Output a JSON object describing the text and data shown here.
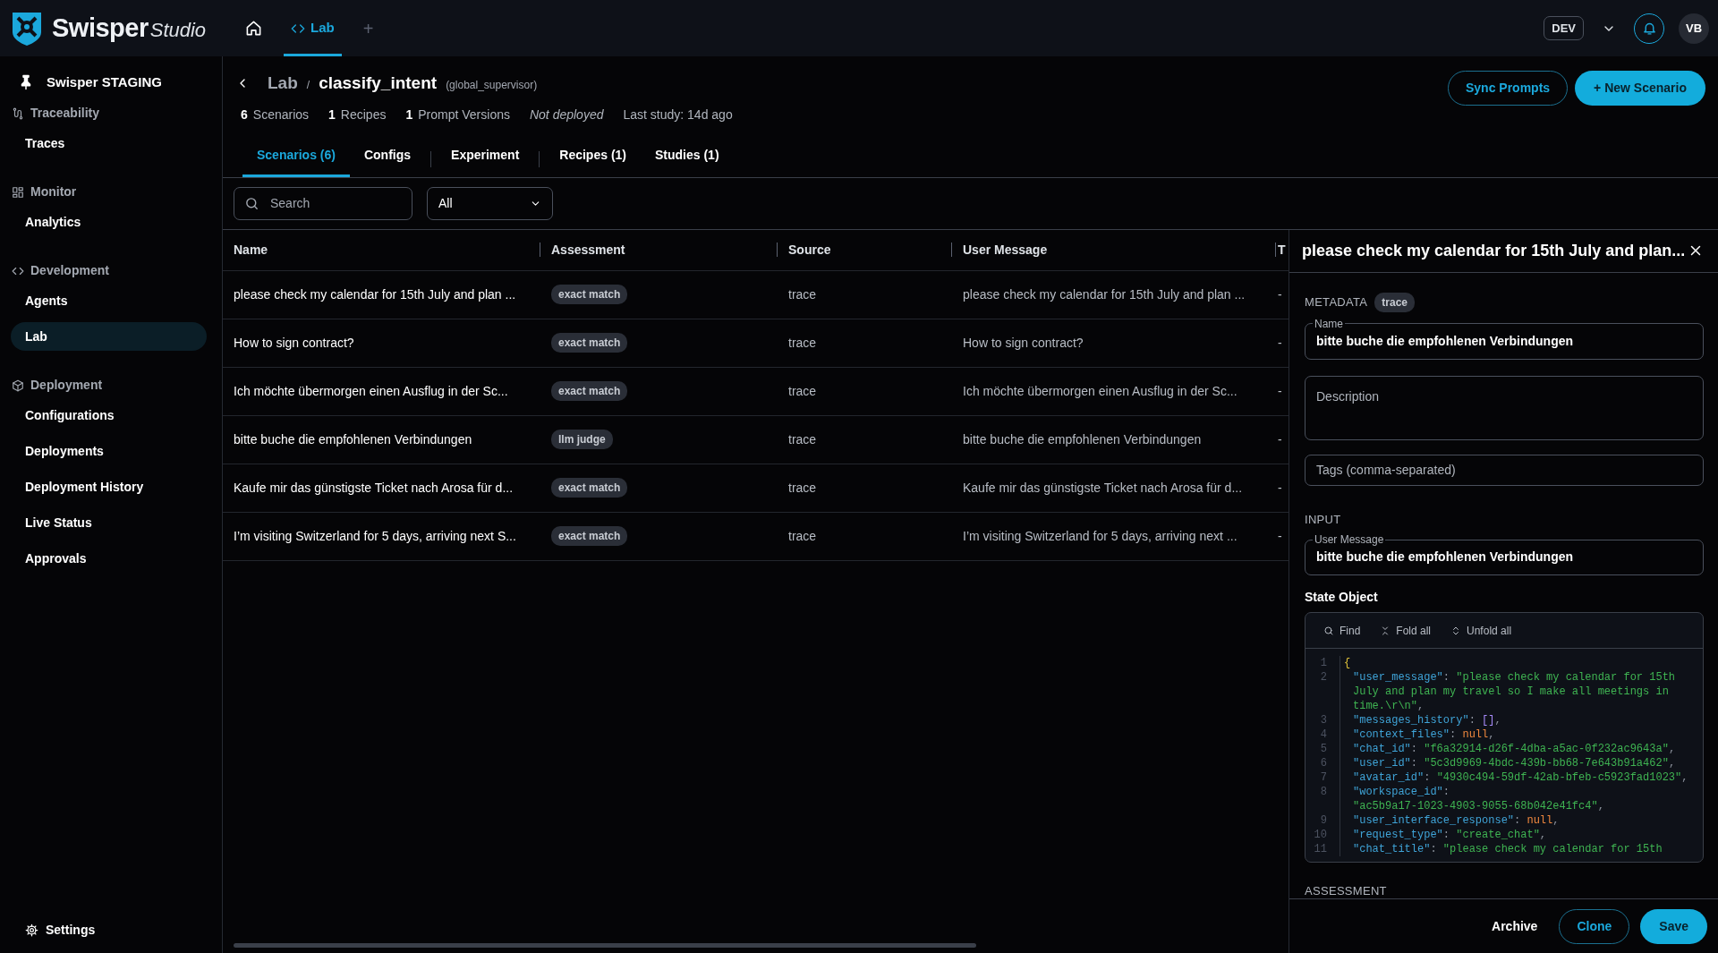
{
  "brand": {
    "name": "Swisper",
    "suffix": "Studio"
  },
  "top_nav": [
    {
      "kind": "home",
      "selected": false
    },
    {
      "kind": "code",
      "label": "Lab",
      "selected": true
    },
    {
      "kind": "add",
      "label": "+",
      "selected": false
    }
  ],
  "environment": {
    "label": "DEV"
  },
  "user": {
    "initials": "VB"
  },
  "sidebar": {
    "workspace": "Swisper STAGING",
    "sections": [
      {
        "title": "Traceability",
        "items": [
          {
            "label": "Traces",
            "selected": false
          }
        ]
      },
      {
        "title": "Monitor",
        "items": [
          {
            "label": "Analytics",
            "selected": false
          }
        ]
      },
      {
        "title": "Development",
        "items": [
          {
            "label": "Agents",
            "selected": false
          },
          {
            "label": "Lab",
            "selected": true
          }
        ]
      },
      {
        "title": "Deployment",
        "items": [
          {
            "label": "Configurations",
            "selected": false
          },
          {
            "label": "Deployments",
            "selected": false
          },
          {
            "label": "Deployment History",
            "selected": false
          },
          {
            "label": "Live Status",
            "selected": false
          },
          {
            "label": "Approvals",
            "selected": false
          }
        ]
      }
    ],
    "settings": "Settings"
  },
  "breadcrumb": {
    "parent": "Lab",
    "separator": "/",
    "current": "classify_intent",
    "context": "(global_supervisor)"
  },
  "stats": [
    {
      "kind": "count",
      "count": "6",
      "label": "Scenarios"
    },
    {
      "kind": "count",
      "count": "1",
      "label": "Recipes"
    },
    {
      "kind": "count",
      "count": "1",
      "label": "Prompt Versions"
    },
    {
      "kind": "status",
      "label": "Not deployed"
    },
    {
      "kind": "info",
      "label": "Last study: 14d ago"
    }
  ],
  "actions": [
    {
      "kind": "outline",
      "label": "Sync Prompts"
    },
    {
      "kind": "primary",
      "label": "+ New Scenario"
    }
  ],
  "tabs": [
    {
      "label": "Scenarios (6)",
      "selected": true,
      "divider_after": false
    },
    {
      "label": "Configs",
      "selected": false,
      "divider_after": true
    },
    {
      "label": "Experiment",
      "selected": false,
      "divider_after": true
    },
    {
      "label": "Recipes (1)",
      "selected": false,
      "divider_after": false
    },
    {
      "label": "Studies (1)",
      "selected": false,
      "divider_after": false
    }
  ],
  "search": {
    "placeholder": "Search"
  },
  "filter": {
    "value": "All"
  },
  "table": {
    "columns": [
      "Name",
      "Assessment",
      "Source",
      "User Message",
      "T"
    ],
    "rows": [
      {
        "name": "please check my calendar for 15th July and plan ...",
        "assessment": "exact match",
        "source": "trace",
        "user_message": "please check my calendar for 15th July and plan ...",
        "column_5": "-"
      },
      {
        "name": "How to sign contract?",
        "assessment": "exact match",
        "source": "trace",
        "user_message": "How to sign contract?",
        "column_5": "-"
      },
      {
        "name": "Ich möchte übermorgen einen Ausflug in der Sc...",
        "assessment": "exact match",
        "source": "trace",
        "user_message": "Ich möchte übermorgen einen Ausflug in der Sc...",
        "column_5": "-"
      },
      {
        "name": "bitte buche die empfohlenen Verbindungen",
        "assessment": "llm judge",
        "source": "trace",
        "user_message": "bitte buche die empfohlenen Verbindungen",
        "column_5": "-"
      },
      {
        "name": "Kaufe mir das günstigste Ticket nach Arosa für d...",
        "assessment": "exact match",
        "source": "trace",
        "user_message": "Kaufe mir das günstigste Ticket nach Arosa für d...",
        "column_5": "-"
      },
      {
        "name": "I’m visiting Switzerland for 5 days, arriving next S...",
        "assessment": "exact match",
        "source": "trace",
        "user_message": "I’m visiting Switzerland for 5 days, arriving next ...",
        "column_5": "-"
      }
    ]
  },
  "panel": {
    "title": "please check my calendar for 15th July and plan...",
    "metadata_label": "METADATA",
    "source_badge": "trace",
    "name_field": {
      "label": "Name",
      "value": "bitte buche die empfohlenen Verbindungen"
    },
    "description": {
      "placeholder": "Description"
    },
    "tags": {
      "placeholder": "Tags (comma-separated)"
    },
    "input_label": "INPUT",
    "user_message_field": {
      "label": "User Message",
      "value": "bitte buche die empfohlenen Verbindungen"
    },
    "state_object": {
      "label": "State Object",
      "toolbar": [
        {
          "kind": "find",
          "label": "Find"
        },
        {
          "kind": "fold",
          "label": "Fold all"
        },
        {
          "kind": "unfold",
          "label": "Unfold all"
        }
      ],
      "lines": [
        {
          "number": "1",
          "rows": [
            {
              "tokens": [
                {
                  "kind": "brace",
                  "text": "{"
                }
              ]
            }
          ]
        },
        {
          "number": "2",
          "rows": [
            {
              "tokens": [
                {
                  "kind": "key",
                  "text": "\"user_message\""
                },
                {
                  "kind": "punct",
                  "text": ": "
                },
                {
                  "kind": "string",
                  "text": "\"please check my calendar for 15th"
                }
              ]
            },
            {
              "tokens": [
                {
                  "kind": "string",
                  "text": "July and plan my travel so I make all meetings in"
                }
              ]
            },
            {
              "tokens": [
                {
                  "kind": "string",
                  "text": "time.\\r\\n\""
                },
                {
                  "kind": "punct",
                  "text": ","
                }
              ]
            }
          ]
        },
        {
          "number": "3",
          "rows": [
            {
              "tokens": [
                {
                  "kind": "key",
                  "text": "\"messages_history\""
                },
                {
                  "kind": "punct",
                  "text": ": "
                },
                {
                  "kind": "bracket",
                  "text": "[]"
                },
                {
                  "kind": "punct",
                  "text": ","
                }
              ]
            }
          ]
        },
        {
          "number": "4",
          "rows": [
            {
              "tokens": [
                {
                  "kind": "key",
                  "text": "\"context_files\""
                },
                {
                  "kind": "punct",
                  "text": ": "
                },
                {
                  "kind": "null",
                  "text": "null"
                },
                {
                  "kind": "punct",
                  "text": ","
                }
              ]
            }
          ]
        },
        {
          "number": "5",
          "rows": [
            {
              "tokens": [
                {
                  "kind": "key",
                  "text": "\"chat_id\""
                },
                {
                  "kind": "punct",
                  "text": ": "
                },
                {
                  "kind": "string",
                  "text": "\"f6a32914-d26f-4dba-a5ac-0f232ac9643a\""
                },
                {
                  "kind": "punct",
                  "text": ","
                }
              ]
            }
          ]
        },
        {
          "number": "6",
          "rows": [
            {
              "tokens": [
                {
                  "kind": "key",
                  "text": "\"user_id\""
                },
                {
                  "kind": "punct",
                  "text": ": "
                },
                {
                  "kind": "string",
                  "text": "\"5c3d9969-4bdc-439b-bb68-7e643b91a462\""
                },
                {
                  "kind": "punct",
                  "text": ","
                }
              ]
            }
          ]
        },
        {
          "number": "7",
          "rows": [
            {
              "tokens": [
                {
                  "kind": "key",
                  "text": "\"avatar_id\""
                },
                {
                  "kind": "punct",
                  "text": ": "
                },
                {
                  "kind": "string",
                  "text": "\"4930c494-59df-42ab-bfeb-c5923fad1023\""
                },
                {
                  "kind": "punct",
                  "text": ","
                }
              ]
            }
          ]
        },
        {
          "number": "8",
          "rows": [
            {
              "tokens": [
                {
                  "kind": "key",
                  "text": "\"workspace_id\""
                },
                {
                  "kind": "punct",
                  "text": ":"
                }
              ]
            },
            {
              "tokens": [
                {
                  "kind": "string",
                  "text": "\"ac5b9a17-1023-4903-9055-68b042e41fc4\""
                },
                {
                  "kind": "punct",
                  "text": ","
                }
              ]
            }
          ]
        },
        {
          "number": "9",
          "rows": [
            {
              "tokens": [
                {
                  "kind": "key",
                  "text": "\"user_interface_response\""
                },
                {
                  "kind": "punct",
                  "text": ": "
                },
                {
                  "kind": "null",
                  "text": "null"
                },
                {
                  "kind": "punct",
                  "text": ","
                }
              ]
            }
          ]
        },
        {
          "number": "10",
          "rows": [
            {
              "tokens": [
                {
                  "kind": "key",
                  "text": "\"request_type\""
                },
                {
                  "kind": "punct",
                  "text": ": "
                },
                {
                  "kind": "string",
                  "text": "\"create_chat\""
                },
                {
                  "kind": "punct",
                  "text": ","
                }
              ]
            }
          ]
        },
        {
          "number": "11",
          "rows": [
            {
              "tokens": [
                {
                  "kind": "key",
                  "text": "\"chat_title\""
                },
                {
                  "kind": "punct",
                  "text": ": "
                },
                {
                  "kind": "string",
                  "text": "\"please check my calendar for 15th"
                }
              ]
            }
          ]
        }
      ]
    },
    "assessment_label": "ASSESSMENT",
    "footer_buttons": [
      {
        "kind": "text",
        "label": "Archive"
      },
      {
        "kind": "outline",
        "label": "Clone"
      },
      {
        "kind": "primary",
        "label": "Save"
      }
    ]
  }
}
